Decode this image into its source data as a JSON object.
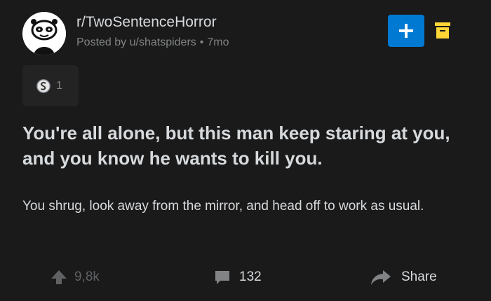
{
  "colors": {
    "background": "#1a1a1b",
    "text_primary": "#d7dadc",
    "text_muted": "#818384",
    "accent_blue": "#0079d3",
    "accent_yellow": "#ffd635"
  },
  "header": {
    "subreddit": "r/TwoSentenceHorror",
    "posted_by": "Posted by u/shatspiders",
    "separator": "•",
    "age": "7mo",
    "avatar_icon": "subreddit-avatar-icon",
    "join_icon": "plus-icon",
    "archive_icon": "archive-icon"
  },
  "award": {
    "icon": "silver-award-icon",
    "count": "1"
  },
  "post": {
    "title": "You're all alone, but this man keep staring at you, and you know he wants to kill you.",
    "body": "You shrug, look away from the mirror, and head off to work as usual."
  },
  "actions": {
    "upvotes": "9,8k",
    "comments": "132",
    "share": "Share"
  }
}
